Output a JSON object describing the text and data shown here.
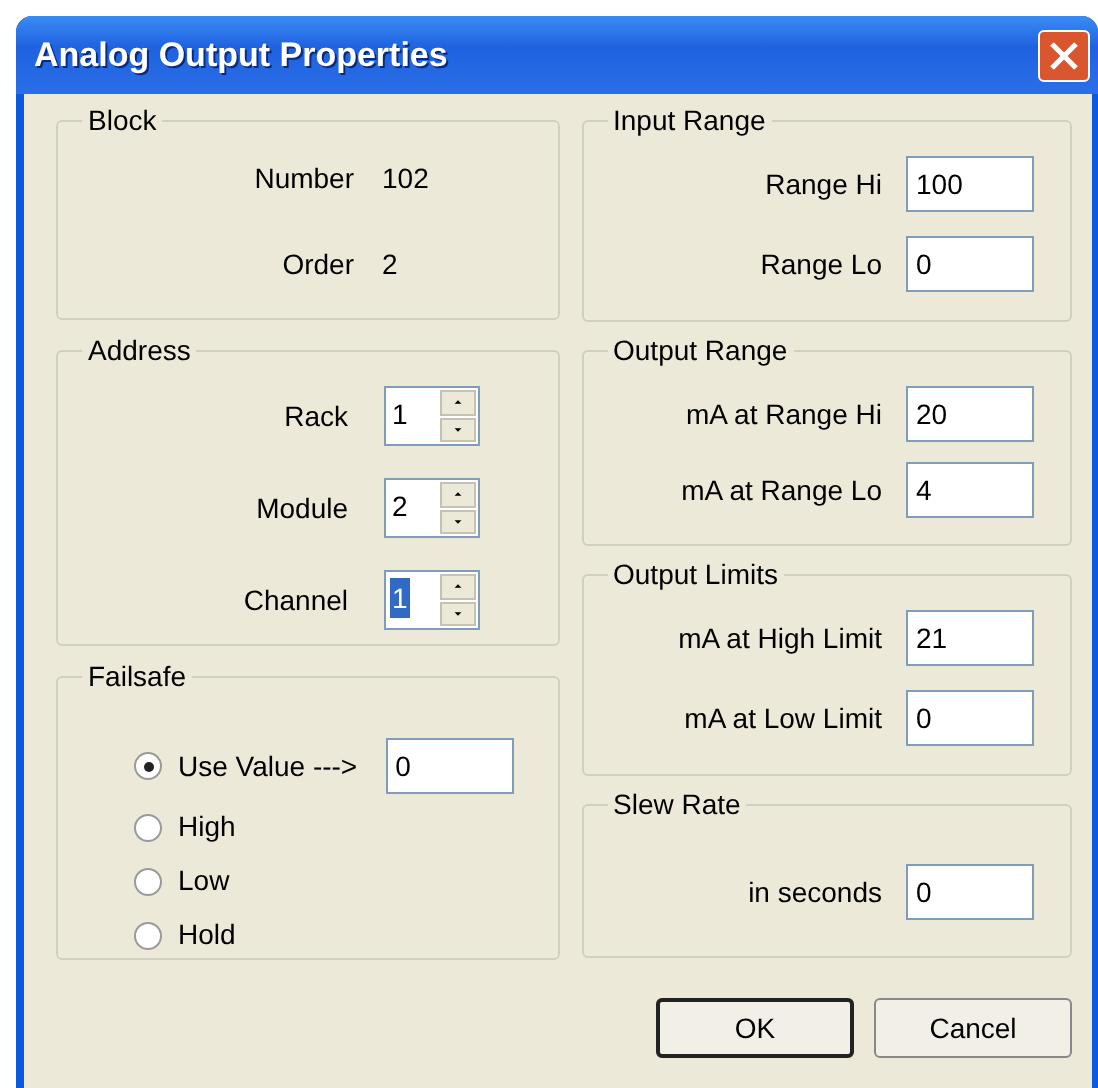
{
  "window": {
    "title": "Analog Output Properties"
  },
  "block": {
    "title": "Block",
    "fields": [
      {
        "label": "Number",
        "value": "102"
      },
      {
        "label": "Order",
        "value": "2"
      }
    ]
  },
  "address": {
    "title": "Address",
    "spinners": [
      {
        "label": "Rack",
        "value": "1",
        "highlighted": false
      },
      {
        "label": "Module",
        "value": "2",
        "highlighted": false
      },
      {
        "label": "Channel",
        "value": "1",
        "highlighted": true
      }
    ]
  },
  "failsafe": {
    "title": "Failsafe",
    "options": [
      {
        "label": "Use Value --->",
        "selected": true,
        "value": "0"
      },
      {
        "label": "High",
        "selected": false
      },
      {
        "label": "Low",
        "selected": false
      },
      {
        "label": "Hold",
        "selected": false
      }
    ]
  },
  "input_range": {
    "title": "Input Range",
    "fields": [
      {
        "label": "Range Hi",
        "value": "100"
      },
      {
        "label": "Range Lo",
        "value": "0"
      }
    ]
  },
  "output_range": {
    "title": "Output Range",
    "fields": [
      {
        "label": "mA at Range Hi",
        "value": "20"
      },
      {
        "label": "mA at Range Lo",
        "value": "4"
      }
    ]
  },
  "output_limits": {
    "title": "Output Limits",
    "fields": [
      {
        "label": "mA at High Limit",
        "value": "21"
      },
      {
        "label": "mA at Low Limit",
        "value": "0"
      }
    ]
  },
  "slew_rate": {
    "title": "Slew Rate",
    "fields": [
      {
        "label": "in seconds",
        "value": "0"
      }
    ]
  },
  "buttons": [
    {
      "label": "OK",
      "default": true
    },
    {
      "label": "Cancel",
      "default": false
    }
  ]
}
